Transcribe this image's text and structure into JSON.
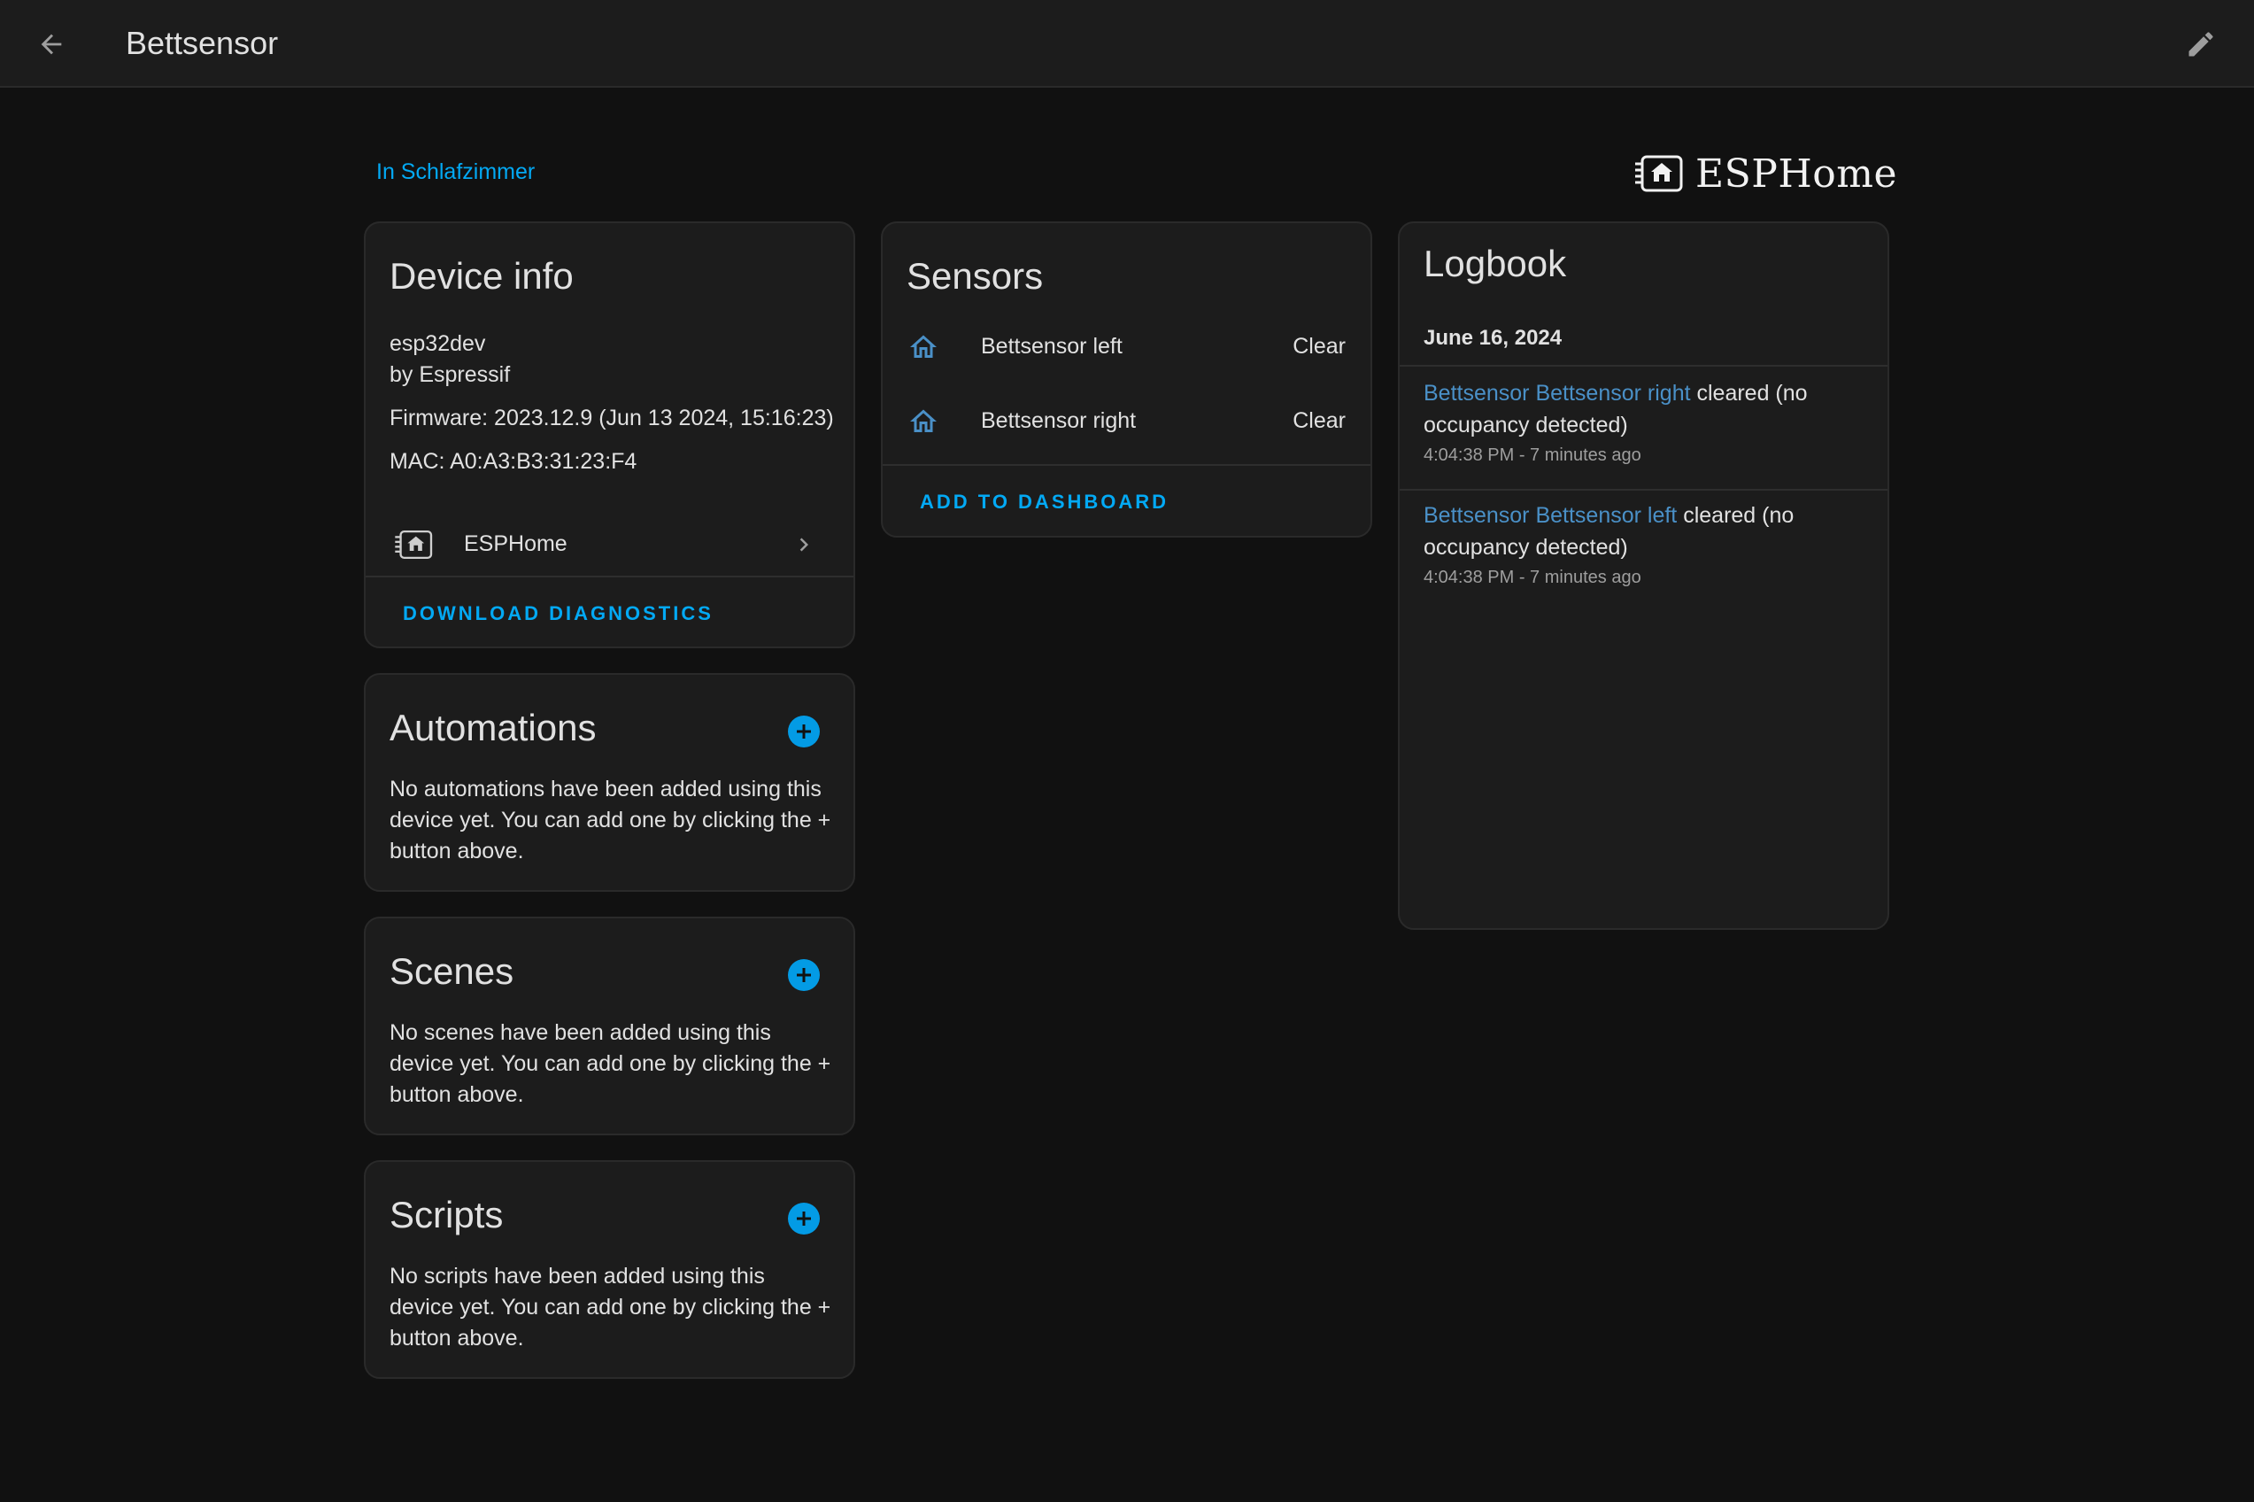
{
  "header": {
    "title": "Bettsensor"
  },
  "area_link": "In Schlafzimmer",
  "brand": "ESPHome",
  "device_info": {
    "title": "Device info",
    "model": "esp32dev",
    "manufacturer": "by Espressif",
    "firmware": "Firmware: 2023.12.9 (Jun 13 2024, 15:16:23)",
    "mac": "MAC: A0:A3:B3:31:23:F4",
    "integration_label": "ESPHome",
    "download_label": "DOWNLOAD DIAGNOSTICS"
  },
  "automations": {
    "title": "Automations",
    "description": "No automations have been added using this device yet. You can add one by clicking the + button above."
  },
  "scenes": {
    "title": "Scenes",
    "description": "No scenes have been added using this device yet. You can add one by clicking the + button above."
  },
  "scripts": {
    "title": "Scripts",
    "description": "No scripts have been added using this device yet. You can add one by clicking the + button above."
  },
  "sensors": {
    "title": "Sensors",
    "items": [
      {
        "name": "Bettsensor left",
        "state": "Clear",
        "icon": "home-outline-icon"
      },
      {
        "name": "Bettsensor right",
        "state": "Clear",
        "icon": "home-outline-icon"
      }
    ],
    "add_label": "ADD TO DASHBOARD"
  },
  "logbook": {
    "title": "Logbook",
    "date": "June 16, 2024",
    "entries": [
      {
        "entity": "Bettsensor Bettsensor right",
        "message": " cleared (no occupancy detected)",
        "time": "4:04:38 PM - 7 minutes ago"
      },
      {
        "entity": "Bettsensor Bettsensor left",
        "message": " cleared (no occupancy detected)",
        "time": "4:04:38 PM - 7 minutes ago"
      }
    ]
  },
  "colors": {
    "accent": "#03a9f4",
    "background": "#111111",
    "card": "#1c1c1c",
    "sensor_icon": "#4a90c7"
  }
}
